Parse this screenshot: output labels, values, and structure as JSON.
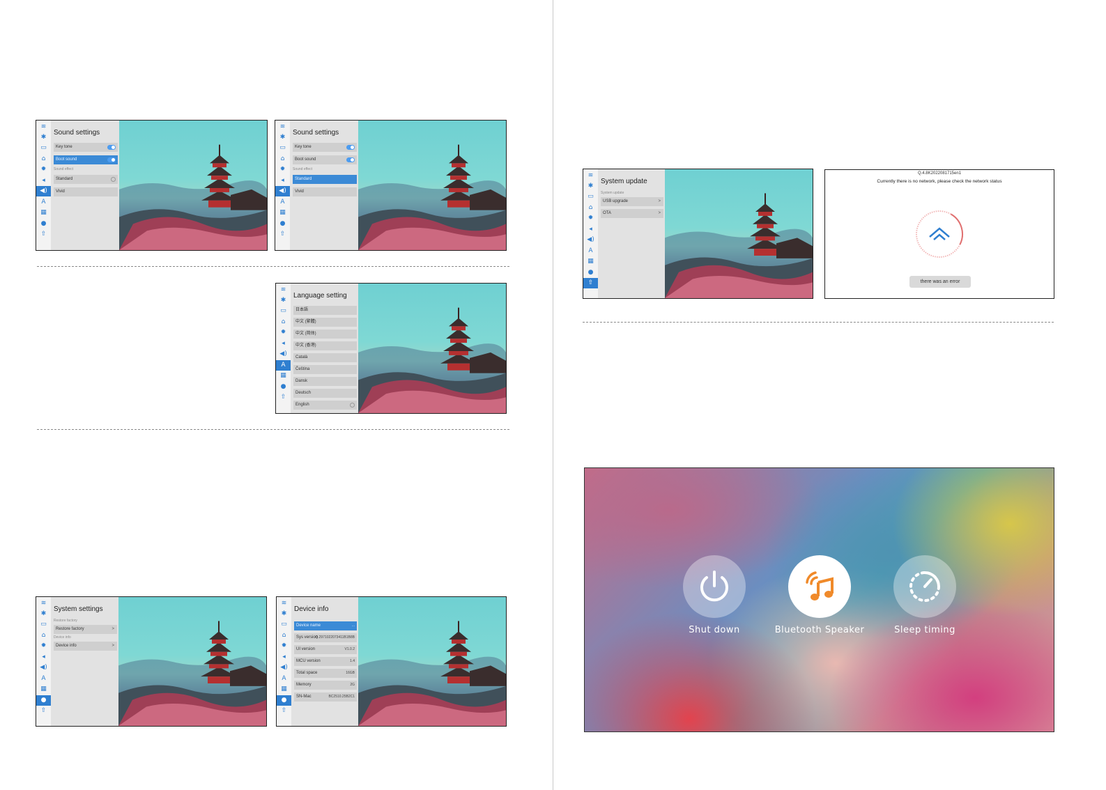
{
  "rail_icons": [
    "wifi-icon",
    "bluetooth-icon",
    "display-icon",
    "projector-icon",
    "gear-icon",
    "keystone-icon",
    "speaker-icon",
    "language-icon",
    "apps-icon",
    "info-icon",
    "update-icon"
  ],
  "sound_screen_1": {
    "title": "Sound settings",
    "items": [
      {
        "label": "Key tone"
      },
      {
        "label": "Boot sound"
      }
    ],
    "section_label": "Sound effect",
    "effects": [
      {
        "label": "Standard"
      },
      {
        "label": "Vivid"
      }
    ]
  },
  "sound_screen_2": {
    "title": "Sound settings",
    "items": [
      {
        "label": "Key tone"
      },
      {
        "label": "Boot sound"
      }
    ],
    "section_label": "Sound effect",
    "effects": [
      {
        "label": "Standard"
      },
      {
        "label": "Vivid"
      }
    ]
  },
  "language_screen": {
    "title": "Language setting",
    "items": [
      "日本語",
      "中文 (繁體)",
      "中文 (简体)",
      "中文 (香港)",
      "Català",
      "Čeština",
      "Dansk",
      "Deutsch",
      "English"
    ]
  },
  "system_screen": {
    "title": "System settings",
    "label_restore": "Restore factory",
    "restore_item": "Restore factory",
    "label_info": "Device info",
    "info_item": "Device info"
  },
  "device_screen": {
    "title": "Device info",
    "rows": [
      {
        "label": "Device name",
        "value": "..."
      },
      {
        "label": "Sys version",
        "value": "Q.2971022073411B1B8B"
      },
      {
        "label": "UI version",
        "value": "V1.0.2"
      },
      {
        "label": "MCU version",
        "value": "1.4"
      },
      {
        "label": "Total space",
        "value": "16GB"
      },
      {
        "label": "Memory",
        "value": "2G"
      },
      {
        "label": "SN-Mac",
        "value": "BC2510.25B2C1"
      }
    ]
  },
  "update_screen": {
    "title": "System update",
    "section_label": "System update",
    "items": [
      "USB upgrade",
      "OTA"
    ]
  },
  "ota_dialog": {
    "version": "Q.4.8K2022081715en1",
    "message": "Currently there is no network, please check the network status",
    "error_button": "there was an error"
  },
  "quick_menu": {
    "buttons": [
      {
        "label": "Shut down",
        "icon": "power-icon"
      },
      {
        "label": "Bluetooth Speaker",
        "icon": "bluetooth-speaker-icon"
      },
      {
        "label": "Sleep timing",
        "icon": "sleep-timer-icon"
      }
    ]
  },
  "colors": {
    "accent": "#2f7fd0",
    "selected_item": "#3b8ad6",
    "speaker_icon": "#f08a2a"
  }
}
